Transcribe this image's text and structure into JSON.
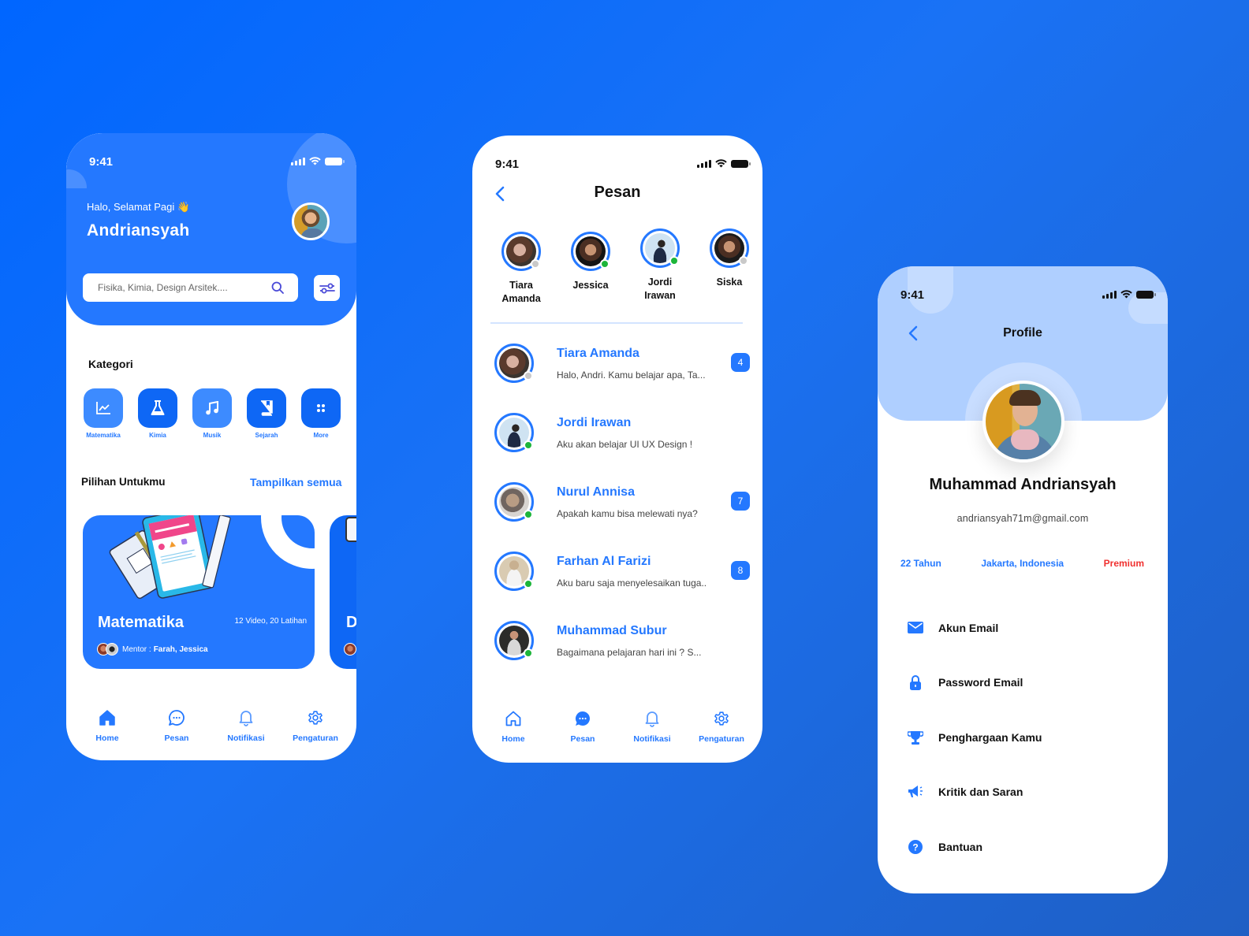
{
  "colors": {
    "primary": "#2478FF",
    "online": "#1DB53A",
    "offline": "#C9C9C9",
    "premium": "#F0302F",
    "profile_header": "#AFCFFF"
  },
  "status_bar": {
    "time": "9:41"
  },
  "home": {
    "greeting": "Halo, Selamat Pagi 👋",
    "username": "Andriansyah",
    "search": {
      "placeholder": "Fisika, Kimia, Design Arsitek....",
      "value": ""
    },
    "kategori_title": "Kategori",
    "categories": [
      {
        "label": "Matematika",
        "icon": "chart-line-icon"
      },
      {
        "label": "Kimia",
        "icon": "flask-icon"
      },
      {
        "label": "Musik",
        "icon": "music-note-icon"
      },
      {
        "label": "Sejarah",
        "icon": "book-icon"
      },
      {
        "label": "More",
        "icon": "grid-dots-icon"
      }
    ],
    "pilihan_title": "Pilihan Untukmu",
    "see_all": "Tampilkan semua",
    "courses": [
      {
        "title": "Matematika",
        "meta": "12 Video, 20 Latihan",
        "mentor_label": "Mentor :",
        "mentors": "Farah, Jessica"
      },
      {
        "title": "D"
      }
    ]
  },
  "nav": [
    {
      "label": "Home",
      "icon": "home-icon"
    },
    {
      "label": "Pesan",
      "icon": "chat-bubble-icon"
    },
    {
      "label": "Notifikasi",
      "icon": "bell-icon"
    },
    {
      "label": "Pengaturan",
      "icon": "gear-icon"
    }
  ],
  "chat": {
    "title": "Pesan",
    "stories": [
      {
        "name": "Tiara Amanda",
        "online": false
      },
      {
        "name": "Jessica",
        "online": true
      },
      {
        "name": "Jordi Irawan",
        "online": true
      },
      {
        "name": "Siska",
        "online": false
      }
    ],
    "conversations": [
      {
        "name": "Tiara Amanda",
        "message": "Halo, Andri. Kamu belajar apa, Ta...",
        "unread": "4",
        "online": false
      },
      {
        "name": "Jordi Irawan",
        "message": "Aku akan belajar UI UX Design !",
        "unread": null,
        "online": true
      },
      {
        "name": "Nurul Annisa",
        "message": "Apakah kamu bisa melewati nya?",
        "unread": "7",
        "online": true
      },
      {
        "name": "Farhan Al Farizi",
        "message": "Aku baru saja menyelesaikan tuga..",
        "unread": "8",
        "online": true
      },
      {
        "name": "Muhammad Subur",
        "message": "Bagaimana  pelajaran hari ini ? S...",
        "unread": null,
        "online": true
      }
    ]
  },
  "profile": {
    "title": "Profile",
    "name": "Muhammad Andriansyah",
    "email": "andriansyah71m@gmail.com",
    "age": "22 Tahun",
    "location": "Jakarta, Indonesia",
    "plan": "Premium",
    "menu": [
      {
        "label": "Akun Email",
        "icon": "envelope-icon"
      },
      {
        "label": "Password Email",
        "icon": "lock-icon"
      },
      {
        "label": "Penghargaan Kamu",
        "icon": "trophy-icon"
      },
      {
        "label": "Kritik dan Saran",
        "icon": "megaphone-icon"
      },
      {
        "label": "Bantuan",
        "icon": "help-circle-icon"
      }
    ]
  }
}
